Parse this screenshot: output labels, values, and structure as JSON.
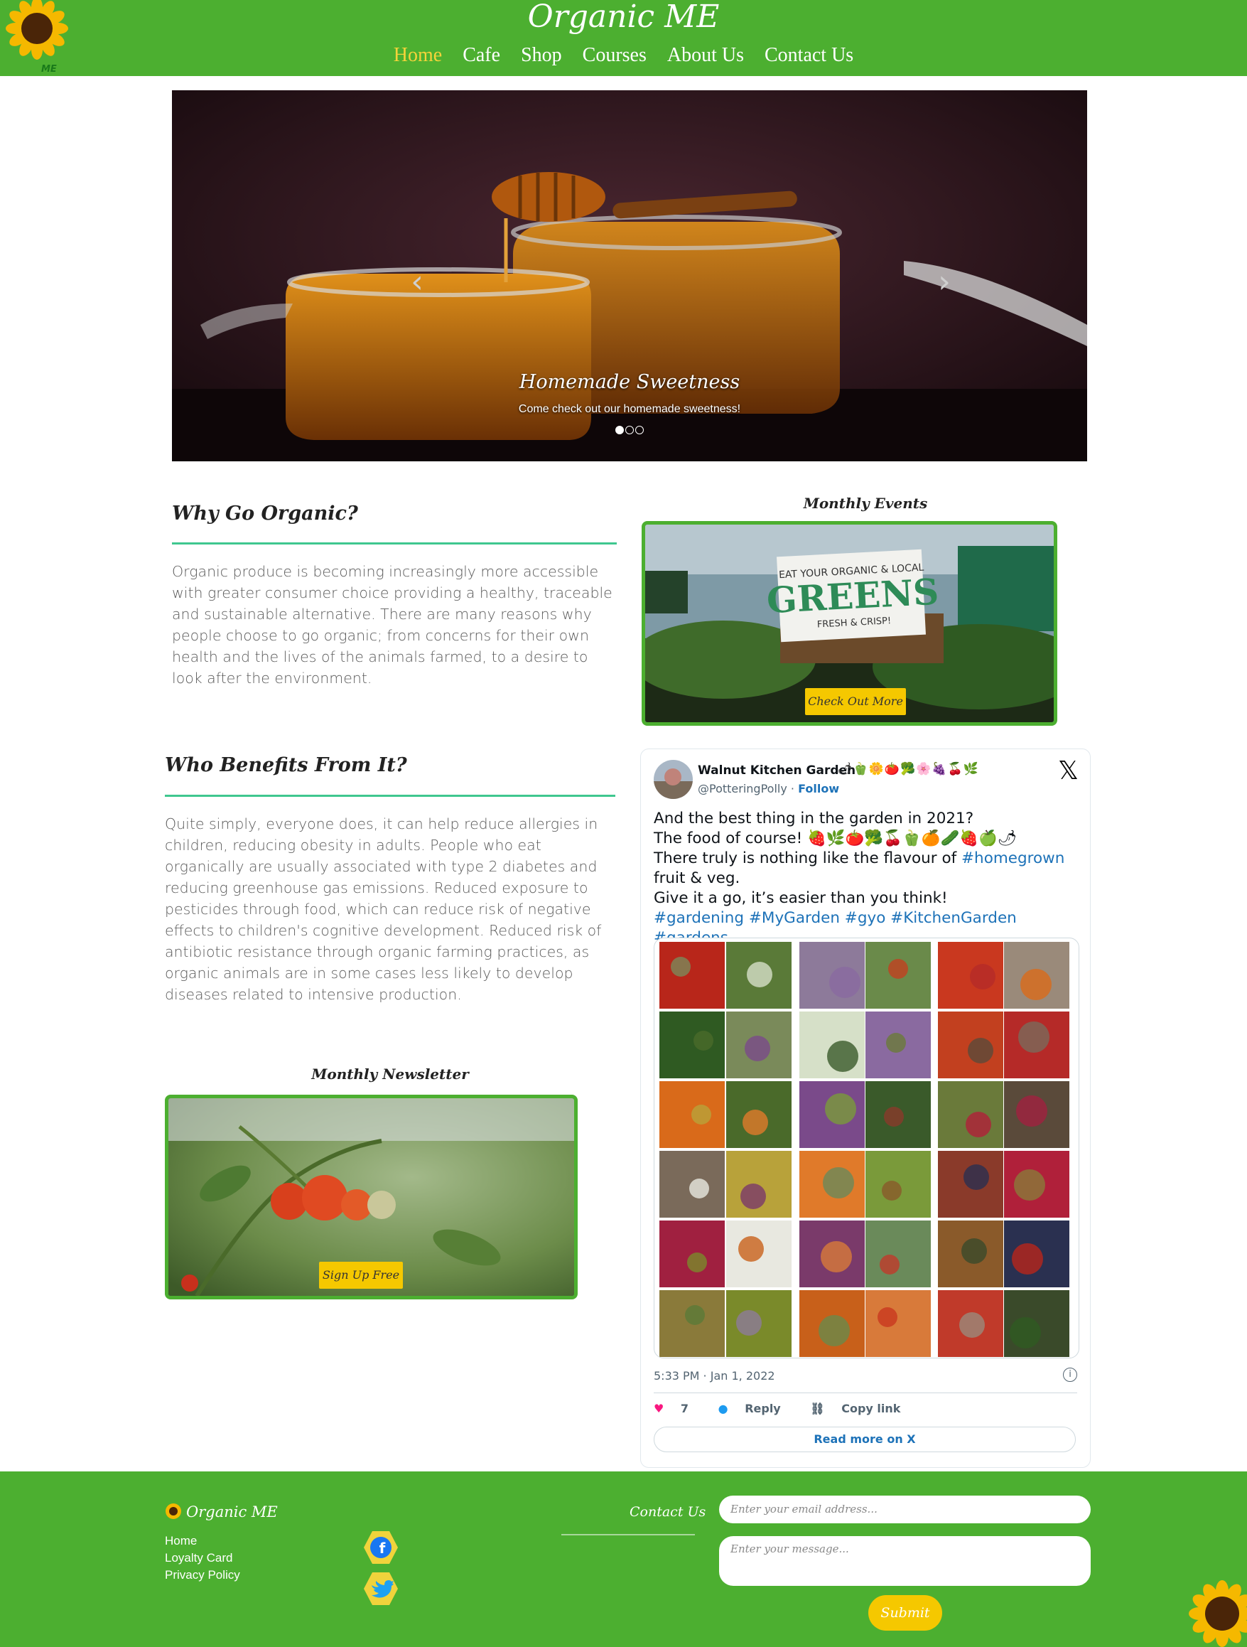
{
  "header": {
    "site_title": "Organic ME",
    "logo_text": "ME",
    "nav": [
      "Home",
      "Cafe",
      "Shop",
      "Courses",
      "About Us",
      "Contact Us"
    ],
    "active_nav": "Home"
  },
  "carousel": {
    "caption_title": "Homemade Sweetness",
    "caption_text": "Come check out our homemade sweetness!",
    "slides": 3,
    "active_slide": 1,
    "prev_icon": "chevron-left-icon",
    "next_icon": "chevron-right-icon"
  },
  "why": {
    "title": "Why Go Organic?",
    "body": "Organic produce is becoming increasingly more accessible with greater consumer choice providing a healthy, traceable and sustainable alternative. There are many reasons why people choose to go organic; from concerns for their own health and the lives of the animals farmed, to a desire to look after the environment."
  },
  "who": {
    "title": "Who Benefits From It?",
    "body": "Quite simply, everyone does, it can help reduce allergies in children, reducing obesity in adults. People who eat organically are usually associated with type 2 diabetes and reducing greenhouse gas emissions. Reduced exposure to pesticides through food, which can reduce risk of negative effects to children's cognitive development. Reduced risk of antibiotic resistance through organic farming practices, as organic animals are in some cases less likely to develop diseases related to intensive production."
  },
  "events": {
    "title": "Monthly Events",
    "button": "Check Out More",
    "sign_text": "EAT YOUR ORGANIC & LOCAL GREENS FRESH & CRISP!"
  },
  "newsletter": {
    "title": "Monthly Newsletter",
    "button": "Sign Up Free"
  },
  "tweet": {
    "name": "Walnut Kitchen Garden",
    "name_emojis": "🌶🫑🌼🍅🥦🌸🍇🍒🌿",
    "handle": "@PotteringPolly",
    "follow": "Follow",
    "line1": "And the best thing in the garden in 2021?",
    "line2": "The food of course! 🍓🌿🍅🥦🍒🫑🍊🥒🍓🍏🌶",
    "line3_pre": "There truly is nothing like the flavour of ",
    "line3_tag": "#homegrown",
    "line4": "fruit & veg.",
    "line5": "Give it a go, it’s easier than you think!",
    "tags": "#gardening #MyGarden #gyo #KitchenGarden #gardens",
    "time": "5:33 PM · Jan 1, 2022",
    "likes": "7",
    "reply": "Reply",
    "copy": "Copy link",
    "read_more": "Read more on X"
  },
  "footer": {
    "brand": "Organic ME",
    "links": [
      "Home",
      "Loyalty Card",
      "Privacy Policy"
    ],
    "contact_title": "Contact Us",
    "email_placeholder": "Enter your email address...",
    "message_placeholder": "Enter your message...",
    "submit": "Submit",
    "social": [
      "facebook-icon",
      "twitter-icon"
    ]
  },
  "colors": {
    "brand_green": "#4caf30",
    "accent_yellow": "#f5c800",
    "nav_active": "#f4d33a",
    "rule_teal": "#3fc78f",
    "link_blue": "#1d72b8"
  }
}
